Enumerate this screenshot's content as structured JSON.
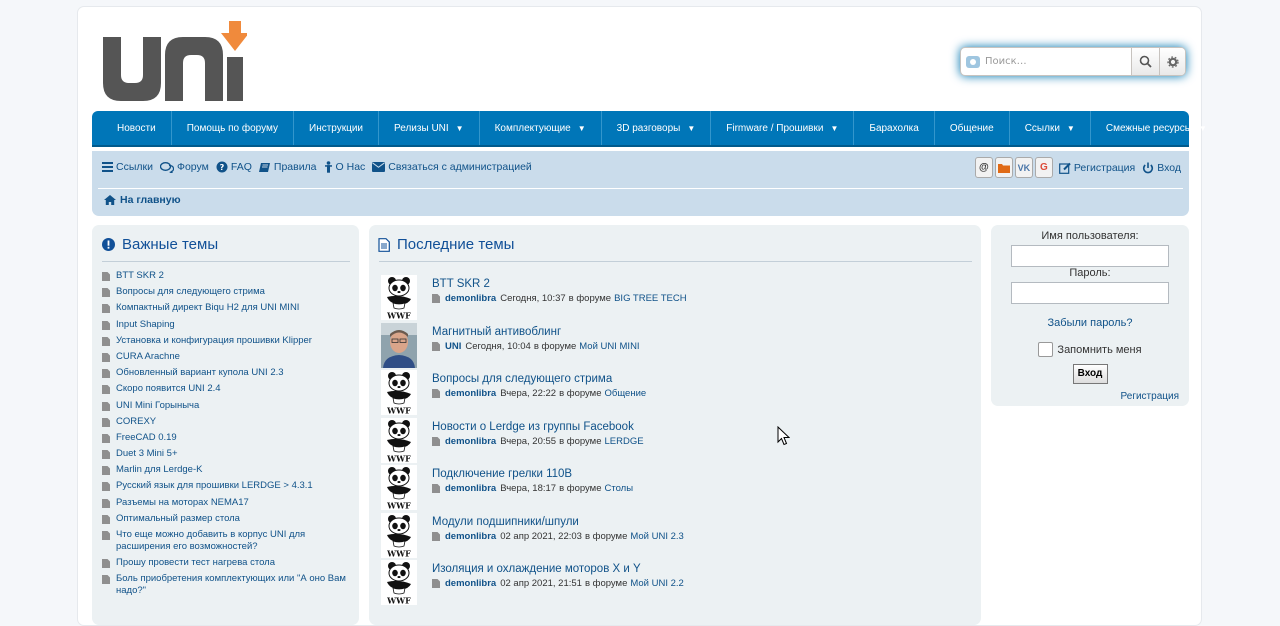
{
  "logo": {
    "text": "uni",
    "colors": {
      "letters": "#555555",
      "arrow": "#f08a3c"
    }
  },
  "search": {
    "placeholder": "Поиск…",
    "icon": "search-icon",
    "advanced_icon": "gear-icon"
  },
  "nav": {
    "items": [
      {
        "label": "Новости",
        "dropdown": false
      },
      {
        "label": "Помощь по форуму",
        "dropdown": false
      },
      {
        "label": "Инструкции",
        "dropdown": false
      },
      {
        "label": "Релизы UNI",
        "dropdown": true
      },
      {
        "label": "Комплектующие",
        "dropdown": true
      },
      {
        "label": "3D разговоры",
        "dropdown": true
      },
      {
        "label": "Firmware / Прошивки",
        "dropdown": true
      },
      {
        "label": "Барахолка",
        "dropdown": false
      },
      {
        "label": "Общение",
        "dropdown": false
      },
      {
        "label": "Ссылки",
        "dropdown": true
      },
      {
        "label": "Смежные ресурсы",
        "dropdown": true
      }
    ],
    "caret": "▼"
  },
  "quicklinks": {
    "links": "Ссылки",
    "forum": "Форум",
    "faq": "FAQ",
    "rules": "Правила",
    "about": "О Нас",
    "contact": "Связаться с администрацией"
  },
  "user_links": {
    "social": [
      "@",
      "▰",
      "VK",
      "G"
    ],
    "register": "Регистрация",
    "login": "Вход"
  },
  "breadcrumb": {
    "home": "На главную"
  },
  "important": {
    "title": "Важные темы",
    "items": [
      "BTT SKR 2",
      "Вопросы для следующего стрима",
      "Компактный директ Biqu H2 для UNI MINI",
      "Input Shaping",
      "Установка и конфигурация прошивки Klipper",
      "CURA Arachne",
      "Обновленный вариант купола UNI 2.3",
      "Скоро появится UNI 2.4",
      "UNI Mini Горыныча",
      "COREXY",
      "FreeCAD 0.19",
      "Duet 3 Mini 5+",
      "Marlin для Lerdge-K",
      "Русский язык для прошивки LERDGE > 4.3.1",
      "Разъемы на моторах NEMA17",
      "Оптимальный размер стола",
      "Что еще можно добавить в корпус UNI для расширения его возможностей?",
      "Прошу провести тест нагрева стола",
      "Боль приобретения комплектующих или \"А оно Вам надо?\""
    ]
  },
  "recent": {
    "title": "Последние темы",
    "in_forum": "в форуме",
    "topics": [
      {
        "title": "BTT SKR 2",
        "author": "demonlibra",
        "time": "Сегодня, 10:37",
        "forum": "BIG TREE TECH",
        "avatar": "panda"
      },
      {
        "title": "Магнитный антивоблинг",
        "author": "UNI",
        "time": "Сегодня, 10:04",
        "forum": "Мой UNI MINI",
        "avatar": "photo"
      },
      {
        "title": "Вопросы для следующего стрима",
        "author": "demonlibra",
        "time": "Вчера, 22:22",
        "forum": "Общение",
        "avatar": "panda"
      },
      {
        "title": "Новости о Lerdge из группы Facebook",
        "author": "demonlibra",
        "time": "Вчера, 20:55",
        "forum": "LERDGE",
        "avatar": "panda"
      },
      {
        "title": "Подключение грелки 110В",
        "author": "demonlibra",
        "time": "Вчера, 18:17",
        "forum": "Столы",
        "avatar": "panda"
      },
      {
        "title": "Модули подшипники/шпули",
        "author": "demonlibra",
        "time": "02 апр 2021, 22:03",
        "forum": "Мой UNI 2.3",
        "avatar": "panda"
      },
      {
        "title": "Изоляция и охлаждение моторов X и Y",
        "author": "demonlibra",
        "time": "02 апр 2021, 21:51",
        "forum": "Мой UNI 2.2",
        "avatar": "panda"
      }
    ],
    "avatar_caption": "WWF"
  },
  "login": {
    "username_label": "Имя пользователя:",
    "password_label": "Пароль:",
    "forgot": "Забыли пароль?",
    "remember": "Запомнить меня",
    "button": "Вход",
    "register": "Регистрация"
  },
  "colors": {
    "nav_bg": "#0076b8",
    "subbar_bg": "#cadceb",
    "panel_bg": "#ecf1f3",
    "link": "#105289"
  }
}
